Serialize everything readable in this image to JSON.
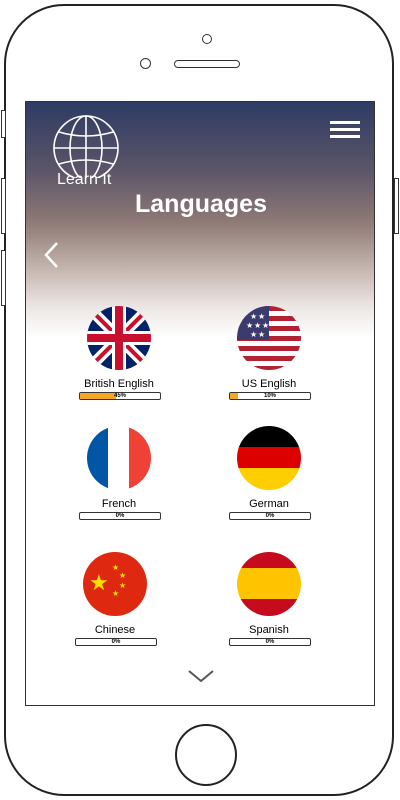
{
  "app": {
    "logo_text": "Learn It",
    "title": "Languages"
  },
  "languages": [
    {
      "name": "British English",
      "progress": 45,
      "progress_label": "45%"
    },
    {
      "name": "US English",
      "progress": 10,
      "progress_label": "10%"
    },
    {
      "name": "French",
      "progress": 0,
      "progress_label": "0%"
    },
    {
      "name": "German",
      "progress": 0,
      "progress_label": "0%"
    },
    {
      "name": "Chinese",
      "progress": 0,
      "progress_label": "0%"
    },
    {
      "name": "Spanish",
      "progress": 0,
      "progress_label": "0%"
    }
  ],
  "icons": {
    "logo": "globe-icon",
    "menu": "hamburger-menu-icon",
    "back": "chevron-left-icon",
    "more": "chevron-down-icon"
  },
  "colors": {
    "progress_fill": "#f5a623",
    "header_top": "#2e3b63"
  }
}
